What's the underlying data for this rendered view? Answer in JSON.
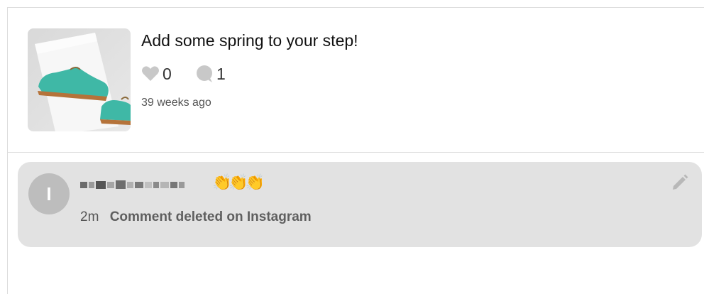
{
  "post": {
    "title": "Add some spring to your step!",
    "likes": "0",
    "comments": "1",
    "time_ago": "39 weeks ago",
    "thumbnail_alt": "teal brogue shoes"
  },
  "comment": {
    "avatar_initial": "I",
    "emoji": "👏👏👏",
    "time": "2m",
    "status": "Comment deleted on Instagram"
  },
  "icons": {
    "like": "heart-icon",
    "comment": "speech-bubble-icon",
    "edit": "pencil-icon"
  },
  "colors": {
    "comment_bg": "#e2e2e2",
    "avatar_bg": "#bdbdbd",
    "icon_gray": "#c8c8c8",
    "shoe_teal": "#3fb8a6"
  }
}
